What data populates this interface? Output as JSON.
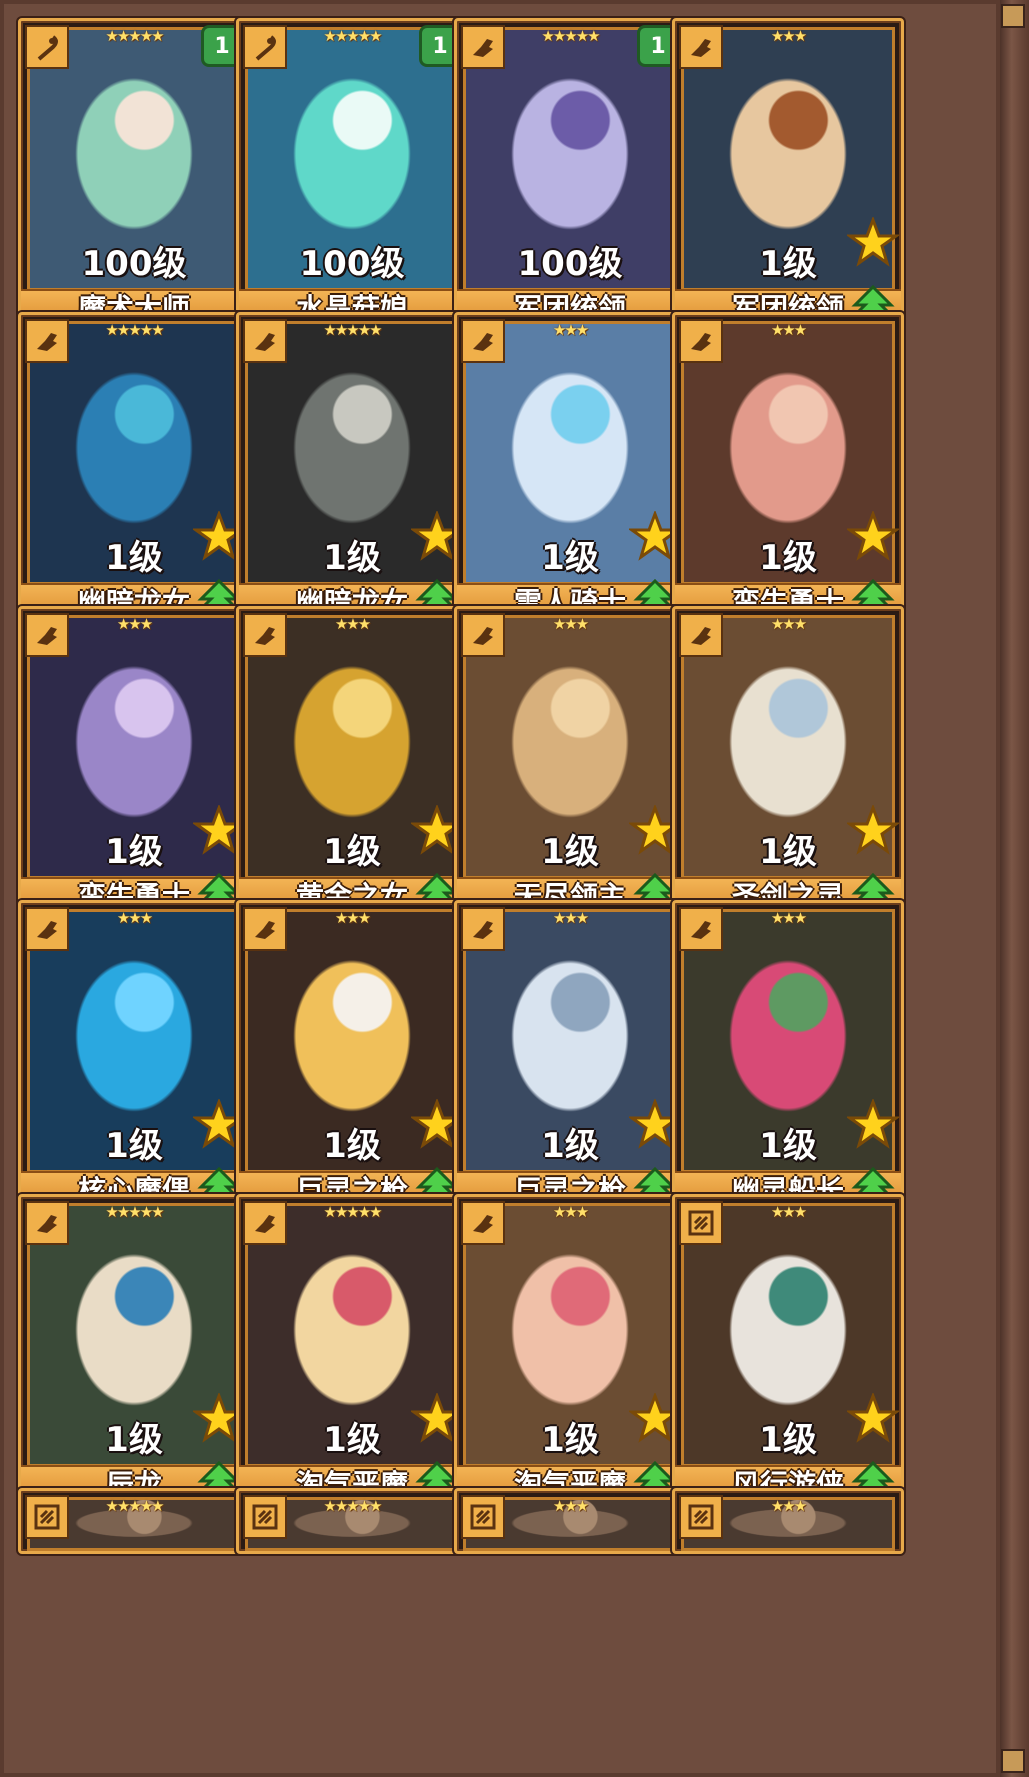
{
  "heroes": [
    {
      "name": "魔术大师",
      "level": "100级",
      "stars": "★★★★★",
      "count": "1",
      "class_icon": "staff-icon",
      "palette": [
        "#3e5a74",
        "#8fd0b8",
        "#f2e3d6"
      ]
    },
    {
      "name": "水晶菇娘",
      "level": "100级",
      "stars": "★★★★★",
      "count": "1",
      "class_icon": "staff-icon",
      "palette": [
        "#2d6f8f",
        "#5fd8c9",
        "#eafaf6"
      ]
    },
    {
      "name": "军团统领",
      "level": "100级",
      "stars": "★★★★★",
      "count": "1",
      "class_icon": "fist-icon",
      "palette": [
        "#3f3e66",
        "#b9b3e2",
        "#6c5ca8"
      ]
    },
    {
      "name": "军团统领",
      "level": "1级",
      "stars": "★★★",
      "class_icon": "fist-icon",
      "palette": [
        "#2f3f52",
        "#e7c79f",
        "#a35a2f"
      ],
      "gold_star": true,
      "upgrade": true
    },
    {
      "name": "幽暗龙女",
      "level": "1级",
      "stars": "★★★★★",
      "class_icon": "fist-icon",
      "palette": [
        "#1e3550",
        "#2b7fb4",
        "#4ab8d8"
      ],
      "gold_star": true,
      "upgrade": true
    },
    {
      "name": "幽暗龙女",
      "level": "1级",
      "stars": "★★★★★",
      "class_icon": "fist-icon",
      "palette": [
        "#2a2a2a",
        "#6f7470",
        "#c8c8c0"
      ],
      "gold_star": true,
      "upgrade": true
    },
    {
      "name": "雪人骑士",
      "level": "1级",
      "stars": "★★★",
      "class_icon": "fist-icon",
      "palette": [
        "#5a7ea6",
        "#d6e6f6",
        "#7ad0ef"
      ],
      "gold_star": true,
      "upgrade": true
    },
    {
      "name": "蛮牛勇士",
      "level": "1级",
      "stars": "★★★",
      "class_icon": "fist-icon",
      "palette": [
        "#5d3a2c",
        "#e29a8b",
        "#f1c6b1"
      ],
      "gold_star": true,
      "upgrade": true
    },
    {
      "name": "蛮牛勇士",
      "level": "1级",
      "stars": "★★★",
      "class_icon": "fist-icon",
      "palette": [
        "#2e2a4a",
        "#9a86c8",
        "#d8c4ee"
      ],
      "gold_star": true,
      "upgrade": true
    },
    {
      "name": "黄金之女",
      "level": "1级",
      "stars": "★★★",
      "class_icon": "fist-icon",
      "palette": [
        "#3c2f24",
        "#d6a330",
        "#f4d57a"
      ],
      "gold_star": true,
      "upgrade": true
    },
    {
      "name": "无尽领主",
      "level": "1级",
      "stars": "★★★",
      "class_icon": "fist-icon",
      "palette": [
        "#6b4d33",
        "#d8b07c",
        "#f0d3a4"
      ],
      "gold_star": true,
      "upgrade": true
    },
    {
      "name": "圣剑之灵",
      "level": "1级",
      "stars": "★★★",
      "class_icon": "fist-icon",
      "palette": [
        "#6b4d33",
        "#e8e0d0",
        "#b0c7d9"
      ],
      "gold_star": true,
      "upgrade": true
    },
    {
      "name": "核心魔偶",
      "level": "1级",
      "stars": "★★★",
      "class_icon": "fist-icon",
      "palette": [
        "#183d5c",
        "#2aa8e0",
        "#6fd3ff"
      ],
      "gold_star": true,
      "upgrade": true
    },
    {
      "name": "巨灵之枪",
      "level": "1级",
      "stars": "★★★",
      "class_icon": "fist-icon",
      "palette": [
        "#3b2a22",
        "#f0c05a",
        "#f5f0e8"
      ],
      "gold_star": true,
      "upgrade": true
    },
    {
      "name": "巨灵之枪",
      "level": "1级",
      "stars": "★★★",
      "class_icon": "fist-icon",
      "palette": [
        "#3a4a62",
        "#d8e3ef",
        "#8fa6bf"
      ],
      "gold_star": true,
      "upgrade": true
    },
    {
      "name": "幽灵船长",
      "level": "1级",
      "stars": "★★★",
      "class_icon": "fist-icon",
      "palette": [
        "#3b3a2c",
        "#d84a76",
        "#5e9a62"
      ],
      "gold_star": true,
      "upgrade": true
    },
    {
      "name": "辰龙",
      "level": "1级",
      "stars": "★★★★★",
      "class_icon": "fist-icon",
      "palette": [
        "#3a4a38",
        "#e9dcc6",
        "#3b86b8"
      ],
      "gold_star": true,
      "upgrade": true
    },
    {
      "name": "淘气恶魔",
      "level": "1级",
      "stars": "★★★★★",
      "class_icon": "fist-icon",
      "palette": [
        "#3d2d2a",
        "#f2d6a0",
        "#d85a6a"
      ],
      "gold_star": true,
      "upgrade": true
    },
    {
      "name": "淘气恶魔",
      "level": "1级",
      "stars": "★★★",
      "class_icon": "fist-icon",
      "palette": [
        "#6b4d33",
        "#f0c0a8",
        "#e06a78"
      ],
      "gold_star": true,
      "upgrade": true
    },
    {
      "name": "风行游侠",
      "level": "1级",
      "stars": "★★★",
      "class_icon": "spiral-icon",
      "palette": [
        "#4d3828",
        "#e8e3dc",
        "#3f8a7a"
      ],
      "gold_star": true,
      "upgrade": true
    }
  ],
  "partial_row": [
    {
      "stars": "★★★★★",
      "class_icon": "spiral-icon"
    },
    {
      "stars": "★★★★★",
      "class_icon": "spiral-icon"
    },
    {
      "stars": "★★★",
      "class_icon": "spiral-icon"
    },
    {
      "stars": "★★★",
      "class_icon": "spiral-icon"
    }
  ]
}
